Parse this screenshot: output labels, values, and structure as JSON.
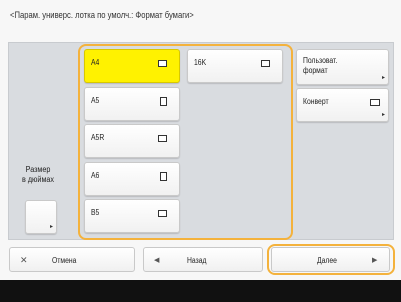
{
  "header": {
    "title": "<Парам. универс. лотка по умолч.: Формат бумаги>"
  },
  "paper_sizes": {
    "a4": "A4",
    "a5": "A5",
    "a5r": "A5R",
    "a6": "A6",
    "b5": "B5",
    "16k": "16K"
  },
  "right_column": {
    "custom_format_line1": "Пользоват.",
    "custom_format_line2": "формат",
    "envelope": "Конверт"
  },
  "left_column": {
    "inch_line1": "Размер",
    "inch_line2": "в дюймах"
  },
  "footer": {
    "cancel": "Отмена",
    "back": "Назад",
    "next": "Далее"
  },
  "colors": {
    "selected": "#fff200",
    "highlight_outline": "#f4b23c"
  },
  "selected_size": "A4"
}
